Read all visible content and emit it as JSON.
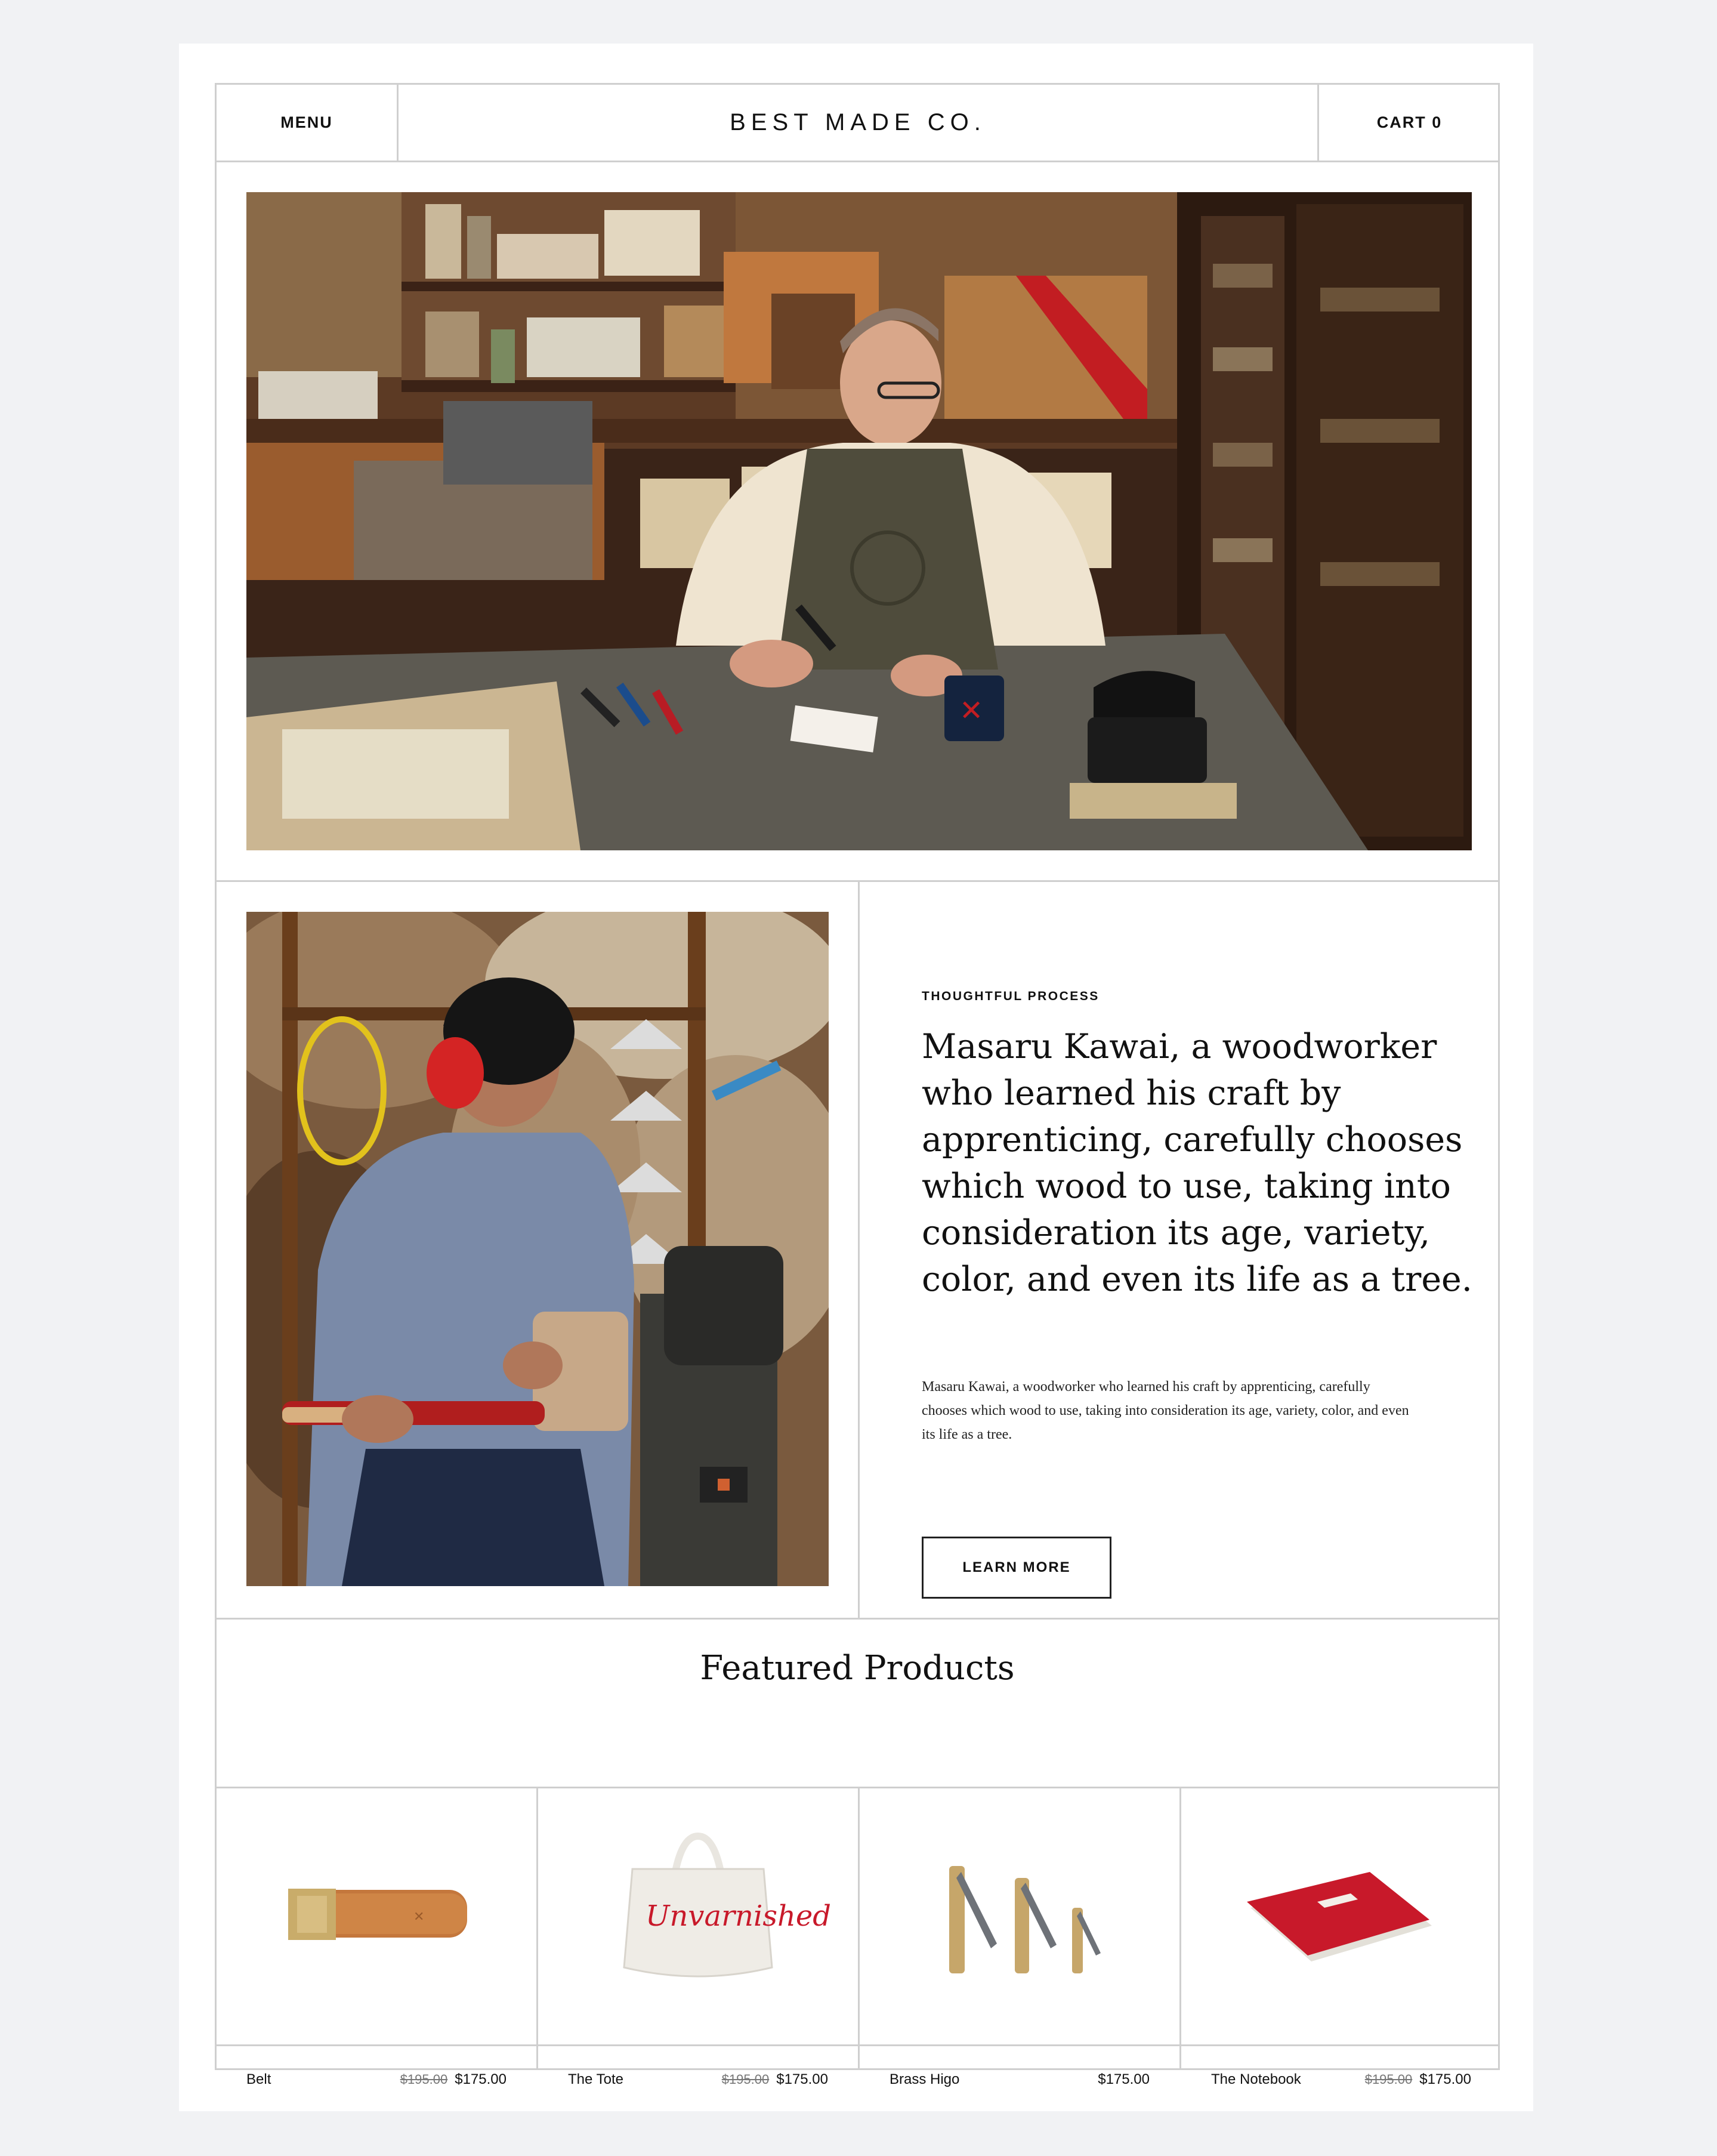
{
  "header": {
    "menu_label": "MENU",
    "brand": "BEST MADE CO.",
    "cart_label": "CART 0"
  },
  "story": {
    "eyebrow": "THOUGHTFUL PROCESS",
    "headline": "Masaru Kawai, a woodworker who learned his craft by apprenticing, carefully chooses which wood to use, taking into consideration its age, variety, color, and even its life as a tree.",
    "body": "Masaru Kawai, a woodworker who learned his craft by apprenticing, carefully chooses which wood to use, taking into consideration its age, variety, color, and even its life as a tree.",
    "cta_label": "LEARN MORE"
  },
  "featured": {
    "title": "Featured Products",
    "products": [
      {
        "name": "Belt",
        "old_price": "$195.00",
        "price": "$175.00"
      },
      {
        "name": "The Tote",
        "old_price": "$195.00",
        "price": "$175.00"
      },
      {
        "name": "Brass Higo",
        "old_price": "",
        "price": "$175.00"
      },
      {
        "name": "The Notebook",
        "old_price": "$195.00",
        "price": "$175.00"
      }
    ]
  },
  "tote_script": "Unvarnished",
  "colors": {
    "page_bg": "#f1f2f4",
    "card_bg": "#ffffff",
    "rule": "#cfcfcf",
    "text": "#111111",
    "accent_red": "#c8192a"
  }
}
